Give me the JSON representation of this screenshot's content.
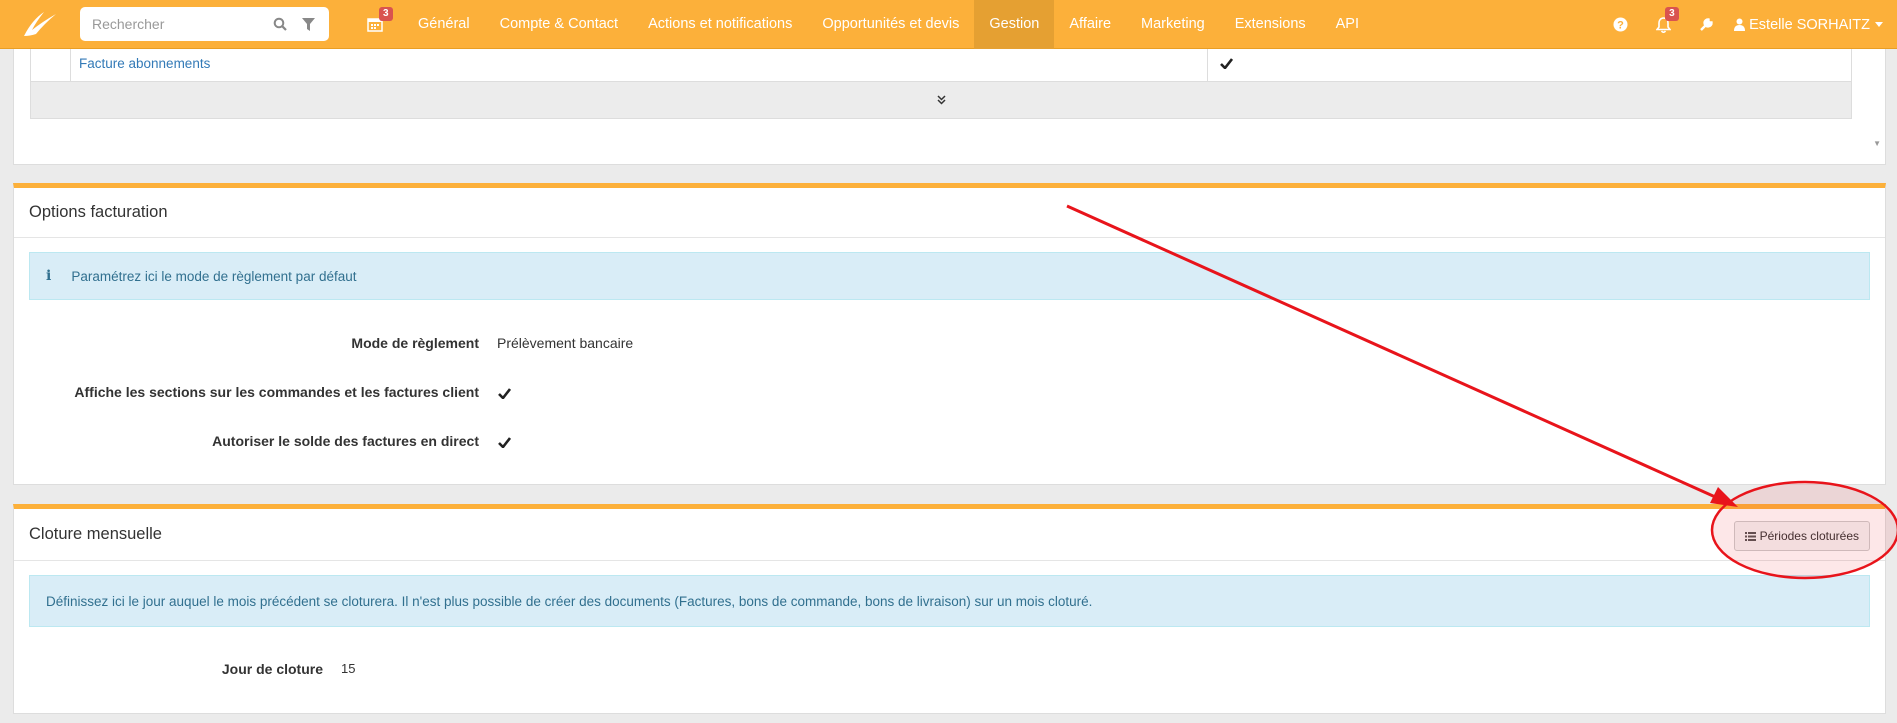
{
  "navbar": {
    "search_placeholder": "Rechercher",
    "calendar_badge": "3",
    "items": [
      {
        "label": "Général",
        "active": false
      },
      {
        "label": "Compte & Contact",
        "active": false
      },
      {
        "label": "Actions et notifications",
        "active": false
      },
      {
        "label": "Opportunités et devis",
        "active": false
      },
      {
        "label": "Gestion",
        "active": true
      },
      {
        "label": "Affaire",
        "active": false
      },
      {
        "label": "Marketing",
        "active": false
      },
      {
        "label": "Extensions",
        "active": false
      },
      {
        "label": "API",
        "active": false
      }
    ],
    "notifications_badge": "3",
    "user_name": "Estelle SORHAITZ",
    "colors": {
      "bar": "#fcb03a",
      "active": "#e5a032",
      "badge": "#d9534f"
    }
  },
  "top_table": {
    "row_label": "Facture abonnements",
    "row_checked": true
  },
  "options_facturation": {
    "title": "Options facturation",
    "info": "Paramétrez ici le mode de règlement par défaut",
    "fields": [
      {
        "label": "Mode de règlement",
        "value": "Prélèvement bancaire"
      },
      {
        "label": "Affiche les sections sur les commandes et les factures client",
        "value": "check"
      },
      {
        "label": "Autoriser le solde des factures en direct",
        "value": "check"
      }
    ]
  },
  "cloture": {
    "title": "Cloture mensuelle",
    "button_label": "Périodes cloturées",
    "info": "Définissez ici le jour auquel le mois précédent se cloturera. Il n'est plus possible de créer des documents (Factures, bons de commande, bons de livraison) sur un mois cloturé.",
    "field_label": "Jour de cloture",
    "field_value": "15"
  },
  "annotation": {
    "color": "#e8141b"
  }
}
